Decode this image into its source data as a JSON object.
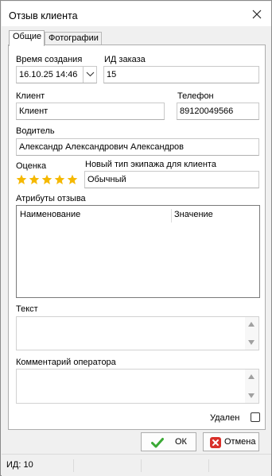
{
  "window": {
    "title": "Отзыв клиента"
  },
  "tabs": [
    {
      "label": "Общие",
      "active": true
    },
    {
      "label": "Фотографии",
      "active": false
    }
  ],
  "form": {
    "created_label": "Время создания",
    "created_value": "16.10.25 14:46",
    "order_id_label": "ИД заказа",
    "order_id_value": "15",
    "client_label": "Клиент",
    "client_value": "Клиент",
    "phone_label": "Телефон",
    "phone_value": "89120049566",
    "driver_label": "Водитель",
    "driver_value": "Александр Александрович Александров",
    "rating_label": "Оценка",
    "rating": 5,
    "rating_max": 5,
    "vehicle_type_label": "Новый тип экипажа для клиента",
    "vehicle_type_value": "Обычный",
    "attributes_label": "Атрибуты отзыва",
    "attributes_columns": [
      "Наименование",
      "Значение"
    ],
    "text_label": "Текст",
    "text_value": "",
    "operator_comment_label": "Комментарий оператора",
    "operator_comment_value": "",
    "deleted_label": "Удален",
    "deleted_checked": false
  },
  "buttons": {
    "ok_label": "ОК",
    "cancel_label": "Отмена"
  },
  "status": {
    "id_text": "ИД: 10"
  },
  "colors": {
    "star": "#f5b800",
    "ok_check": "#3aa935",
    "cancel_x": "#d9302a"
  },
  "icons": {
    "close": "close-icon",
    "dropdown": "chevron-down-icon",
    "star": "star-icon",
    "ok": "checkmark-icon",
    "cancel": "x-icon"
  }
}
